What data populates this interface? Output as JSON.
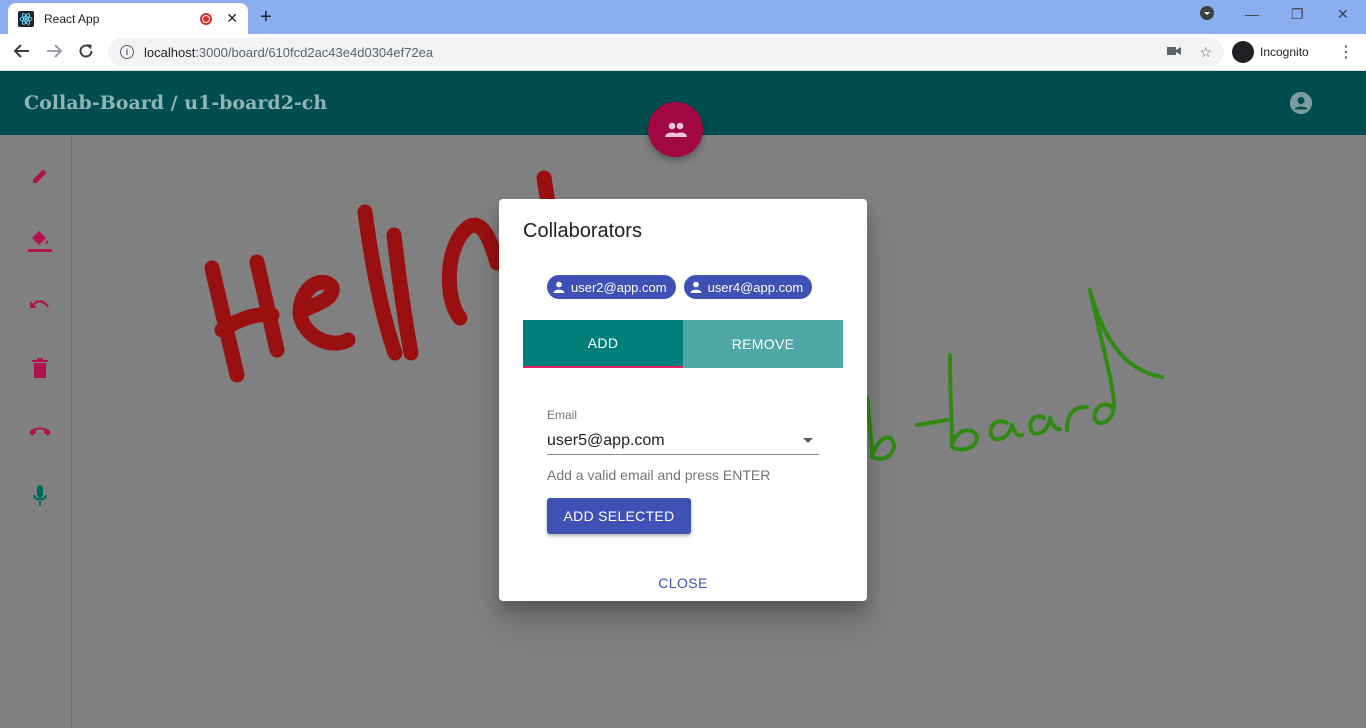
{
  "browser": {
    "tab_title": "React App",
    "url_host": "localhost",
    "url_rest": ":3000/board/610fcd2ac43e4d0304ef72ea",
    "profile_label": "Incognito"
  },
  "app": {
    "title": "Collab-Board / u1-board2-ch"
  },
  "sidebar": {
    "tools": [
      "pencil-icon",
      "fill-bucket-icon",
      "undo-icon",
      "delete-icon",
      "end-call-icon",
      "mic-icon"
    ]
  },
  "dialog": {
    "title": "Collaborators",
    "chips": [
      {
        "label": "user2@app.com"
      },
      {
        "label": "user4@app.com"
      }
    ],
    "tabs": [
      {
        "label": "ADD"
      },
      {
        "label": "REMOVE"
      }
    ],
    "email_label": "Email",
    "email_value": "user5@app.com",
    "helper_text": "Add a valid email and press ENTER",
    "add_selected_label": "ADD SELECTED",
    "close_label": "CLOSE"
  },
  "colors": {
    "appbar": "#004d50",
    "fab": "#a10740",
    "accent_indigo": "#3f51b5",
    "tab_active": "#007f7d",
    "tab_inactive": "#4fa8a6",
    "drawing_red": "#9a1010",
    "drawing_green": "#2f8a12"
  }
}
